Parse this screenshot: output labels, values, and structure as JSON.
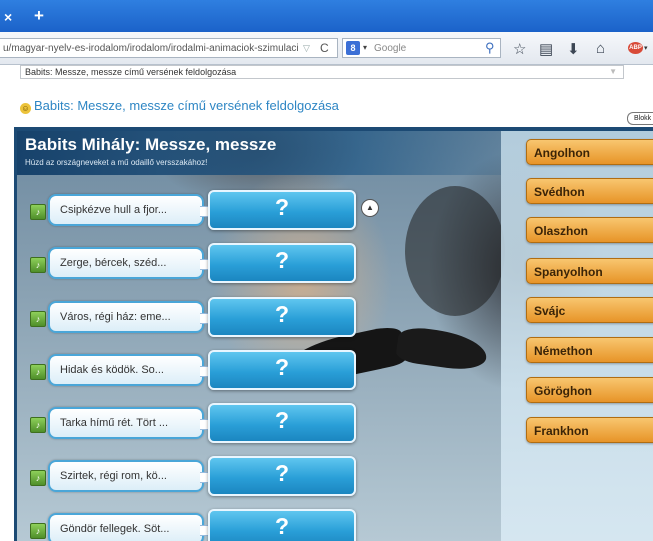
{
  "browser": {
    "tab_close": "×",
    "new_tab": "+",
    "url": "u/magyar-nyelv-es-irodalom/irodalom/irodalmi-animaciok-szimulaciok/iroda",
    "search_placeholder": "Google",
    "search_engine_letter": "8"
  },
  "page": {
    "select_value": "Babits: Messze, messze című versének feldolgozása",
    "title": "Babits: Messze, messze című versének feldolgozása",
    "blokk_label": "Blokk"
  },
  "stage": {
    "title": "Babits Mihály: Messze, messze",
    "subtitle": "Húzd az országneveket a mű odaillő versszakához!",
    "rows": [
      {
        "verse": "Csipkézve hull a fjor...",
        "drop": "?"
      },
      {
        "verse": "Zerge, bércek, széd...",
        "drop": "?"
      },
      {
        "verse": "Város, régi ház: eme...",
        "drop": "?"
      },
      {
        "verse": "Hidak és ködök. So...",
        "drop": "?"
      },
      {
        "verse": "Tarka hímű rét. Tört ...",
        "drop": "?"
      },
      {
        "verse": "Szirtek, régi rom, kö...",
        "drop": "?"
      },
      {
        "verse": "Göndör fellegek. Söt...",
        "drop": "?"
      }
    ],
    "countries": [
      "Angolhon",
      "Svédhon",
      "Olaszhon",
      "Spanyolhon",
      "Svájc",
      "Némethon",
      "Göröghon",
      "Frankhon"
    ]
  }
}
